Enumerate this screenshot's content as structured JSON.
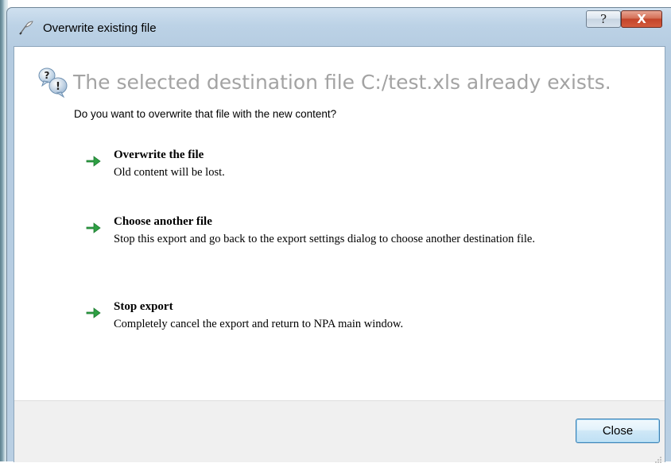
{
  "window": {
    "title": "Overwrite existing file",
    "title_icon": "quill-icon",
    "help_label": "?",
    "close_label": "X"
  },
  "dialog": {
    "main_instruction": "The selected destination file C:/test.xls already exists.",
    "main_instruction_icon": "question-bubbles-icon",
    "content": "Do you want to overwrite that file with the new content?",
    "commands": [
      {
        "title": "Overwrite the file",
        "description": "Old content will be lost.",
        "icon": "green-arrow-icon"
      },
      {
        "title": "Choose another file",
        "description": "Stop this export and go back to the export settings dialog to choose another destination file.",
        "icon": "green-arrow-icon"
      },
      {
        "title": "Stop export",
        "description": "Completely cancel the export and return to NPA main window.",
        "icon": "green-arrow-icon"
      }
    ]
  },
  "footer": {
    "close_button": "Close"
  },
  "colors": {
    "arrow_green": "#2ea043",
    "main_instruction": "#a3a3a3",
    "title_close_red": "#c3442a"
  }
}
